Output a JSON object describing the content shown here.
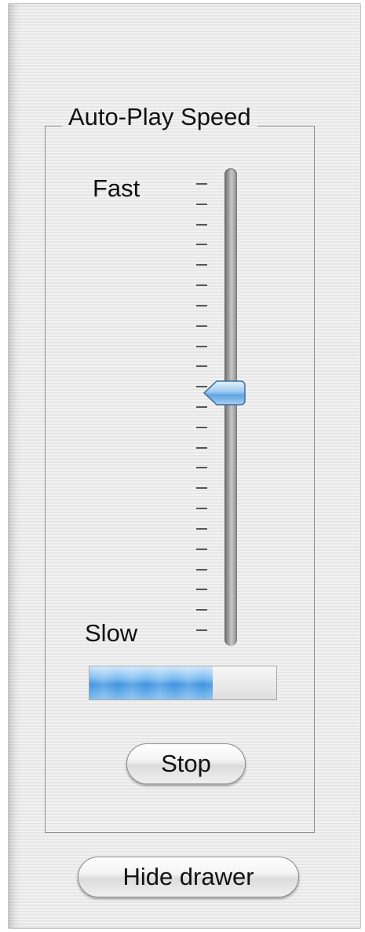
{
  "group": {
    "title": "Auto-Play Speed"
  },
  "slider": {
    "fast_label": "Fast",
    "slow_label": "Slow",
    "value_fraction": 0.53,
    "tick_count": 23
  },
  "progress": {
    "value_fraction": 0.66
  },
  "buttons": {
    "stop_label": "Stop",
    "hide_drawer_label": "Hide drawer"
  },
  "colors": {
    "progress_fill": "#3f93e0",
    "thumb": "#7fb6e8"
  },
  "icons": {
    "slider_thumb": "slider-thumb-icon"
  }
}
